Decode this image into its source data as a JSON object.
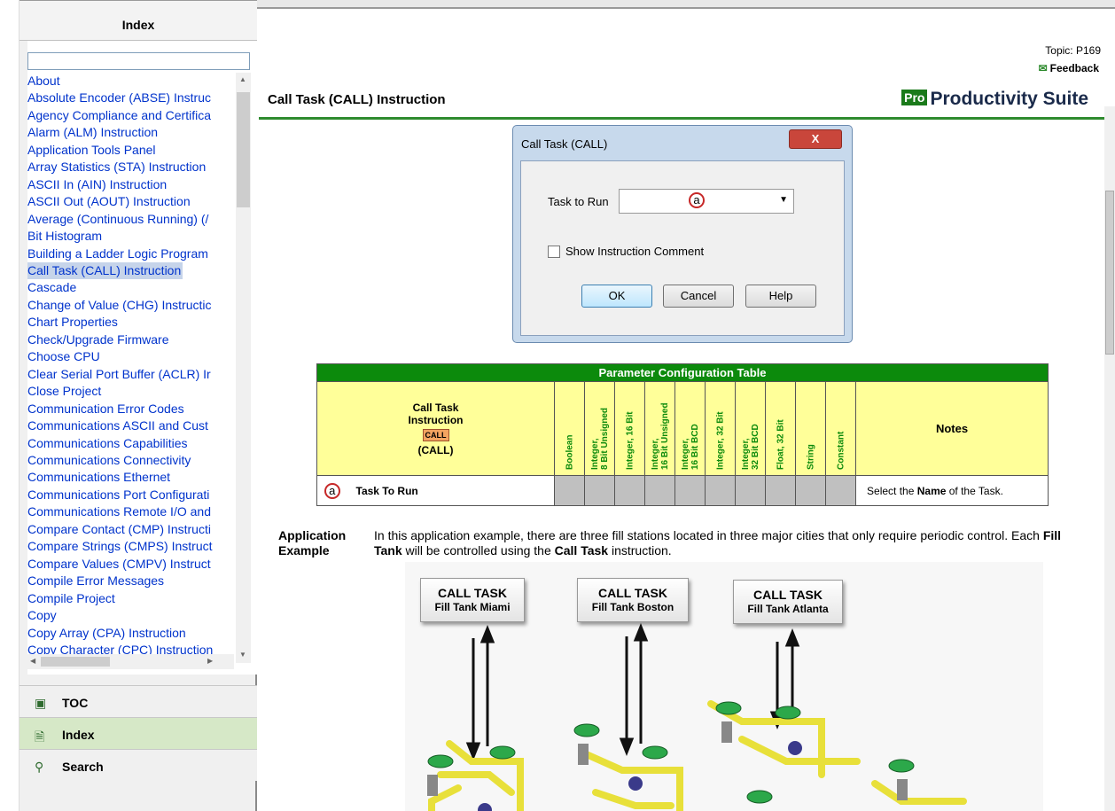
{
  "left_panel": {
    "header": "Index",
    "index_items": [
      "About",
      "Absolute Encoder (ABSE) Instruc",
      "Agency Compliance and Certifica",
      "Alarm (ALM) Instruction",
      "Application Tools Panel",
      "Array Statistics (STA) Instruction",
      "ASCII In (AIN) Instruction",
      "ASCII Out (AOUT) Instruction",
      "Average (Continuous Running) (/",
      "Bit Histogram",
      "Building a Ladder Logic Program",
      "Call Task (CALL) Instruction",
      "Cascade",
      "Change of Value (CHG) Instructic",
      "Chart Properties",
      "Check/Upgrade Firmware",
      "Choose CPU",
      "Clear Serial Port Buffer (ACLR) Ir",
      "Close Project",
      "Communication Error Codes",
      "Communications ASCII and Cust",
      "Communications Capabilities",
      "Communications Connectivity",
      "Communications Ethernet",
      "Communications Port Configurati",
      "Communications Remote I/O and",
      "Compare Contact (CMP) Instructi",
      "Compare Strings (CMPS) Instruct",
      "Compare Values (CMPV) Instruct",
      "Compile Error Messages",
      "Compile Project",
      "Copy",
      "Copy Array (CPA) Instruction",
      "Copy Character (CPC) Instruction"
    ],
    "selected_index": 11,
    "tabs": [
      {
        "icon": "book-icon",
        "label": "TOC"
      },
      {
        "icon": "page-icon",
        "label": "Index"
      },
      {
        "icon": "magnifier-icon",
        "label": "Search"
      }
    ],
    "active_tab": "Index"
  },
  "main": {
    "topic": "Topic: P169",
    "feedback": "Feedback",
    "title": "Call Task (CALL) Instruction",
    "brand_logo": "Pro",
    "brand_name": "Productivity Suite",
    "dialog": {
      "title": "Call Task (CALL)",
      "close": "X",
      "task_label": "Task to Run",
      "task_marker": "a",
      "checkbox_label": "Show Instruction Comment",
      "buttons": [
        "OK",
        "Cancel",
        "Help"
      ]
    },
    "table": {
      "header": "Parameter Configuration Table",
      "first_col_lines": [
        "Call Task",
        "Instruction"
      ],
      "badge": "CALL",
      "paren": "(CALL)",
      "columns": [
        [
          "Boolean"
        ],
        [
          "Integer,",
          "8 Bit Unsigned"
        ],
        [
          "Integer, 16 Bit"
        ],
        [
          "Integer,",
          "16 Bit Unsigned"
        ],
        [
          "Integer,",
          "16 Bit BCD"
        ],
        [
          "Integer, 32 Bit"
        ],
        [
          "Integer,",
          "32 Bit BCD"
        ],
        [
          "Float, 32 Bit"
        ],
        [
          "String"
        ],
        [
          "Constant"
        ]
      ],
      "notes_header": "Notes",
      "row_marker": "a",
      "row_label": "Task To Run",
      "row_note_pre": "Select the ",
      "row_note_bold": "Name",
      "row_note_post": " of the Task."
    },
    "application": {
      "label_1": "Application",
      "label_2": "Example",
      "t1": "In this application example, there are three fill stations located in three major cities that only require periodic control.  Each ",
      "t2": "Fill Tank",
      "t3": " will be controlled using the ",
      "t4": "Call Task",
      "t5": " instruction."
    },
    "illustration": [
      {
        "line1": "CALL TASK",
        "line2": "Fill Tank Miami"
      },
      {
        "line1": "CALL TASK",
        "line2": "Fill Tank Boston"
      },
      {
        "line1": "CALL TASK",
        "line2": "Fill Tank Atlanta"
      }
    ]
  },
  "colors": {
    "accent_green": "#0c8a0c",
    "link_blue": "#0033cc",
    "table_yellow": "#ffff99",
    "pipe_yellow": "#e8e03a"
  }
}
